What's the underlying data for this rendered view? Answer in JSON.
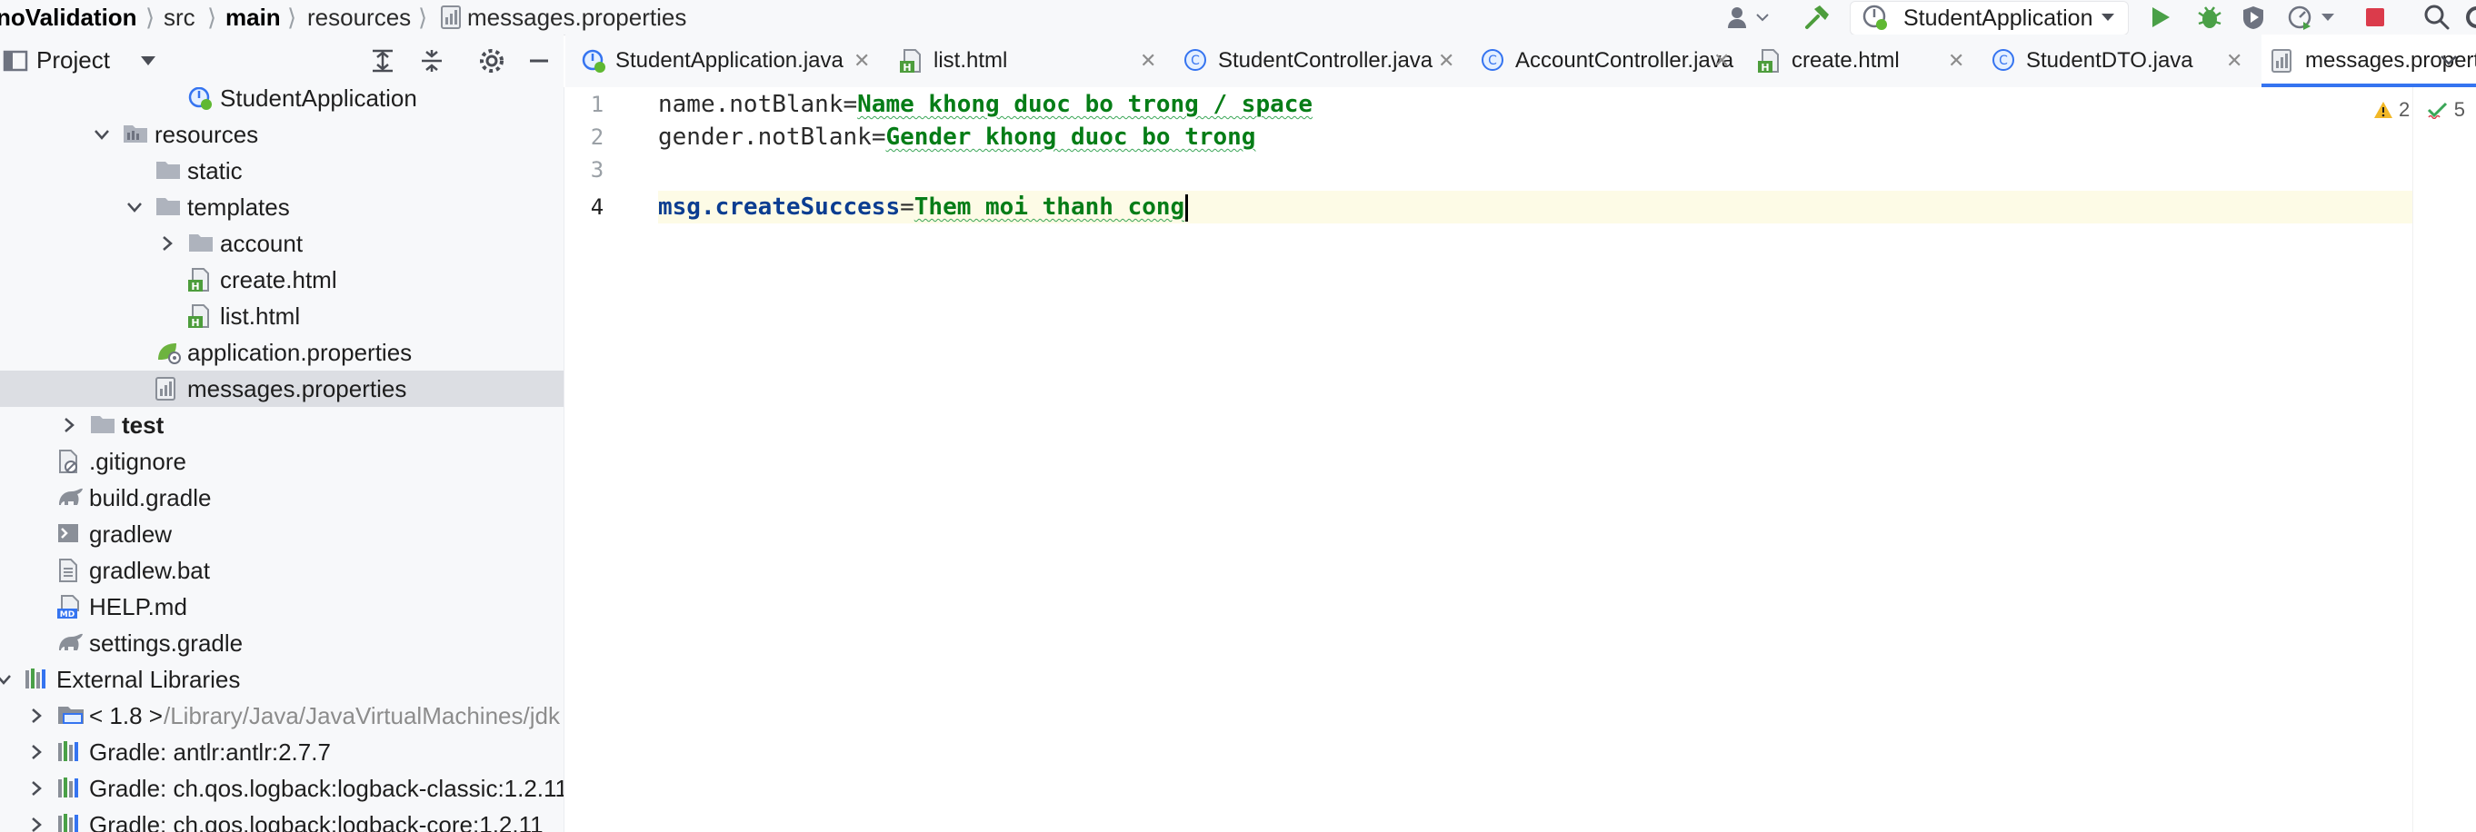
{
  "breadcrumb": {
    "items": [
      "noValidation",
      "src",
      "main",
      "resources",
      "messages.properties"
    ],
    "separator": "⟩"
  },
  "toolbar": {
    "run_config": "StudentApplication"
  },
  "project_panel": {
    "title": "Project",
    "tree": [
      {
        "label": "StudentApplication",
        "icon": "spring-boot-run-icon",
        "depth": 5,
        "chevron": "none"
      },
      {
        "label": "resources",
        "icon": "resources-folder-icon",
        "depth": 3,
        "chevron": "down"
      },
      {
        "label": "static",
        "icon": "folder-icon",
        "depth": 4,
        "chevron": "none"
      },
      {
        "label": "templates",
        "icon": "folder-icon",
        "depth": 4,
        "chevron": "down"
      },
      {
        "label": "account",
        "icon": "folder-icon",
        "depth": 5,
        "chevron": "right"
      },
      {
        "label": "create.html",
        "icon": "html-file-icon",
        "depth": 5,
        "chevron": "none"
      },
      {
        "label": "list.html",
        "icon": "html-file-icon",
        "depth": 5,
        "chevron": "none"
      },
      {
        "label": "application.properties",
        "icon": "spring-properties-icon",
        "depth": 4,
        "chevron": "none"
      },
      {
        "label": "messages.properties",
        "icon": "properties-file-icon",
        "depth": 4,
        "chevron": "none",
        "selected": true
      },
      {
        "label": "test",
        "icon": "folder-icon",
        "depth": 2,
        "chevron": "right",
        "bold": true
      },
      {
        "label": ".gitignore",
        "icon": "gitignore-file-icon",
        "depth": 1,
        "chevron": "none"
      },
      {
        "label": "build.gradle",
        "icon": "gradle-elephant-icon",
        "depth": 1,
        "chevron": "none"
      },
      {
        "label": "gradlew",
        "icon": "shell-script-icon",
        "depth": 1,
        "chevron": "none"
      },
      {
        "label": "gradlew.bat",
        "icon": "text-file-icon",
        "depth": 1,
        "chevron": "none"
      },
      {
        "label": "HELP.md",
        "icon": "markdown-file-icon",
        "depth": 1,
        "chevron": "none"
      },
      {
        "label": "settings.gradle",
        "icon": "gradle-elephant-icon",
        "depth": 1,
        "chevron": "none"
      },
      {
        "label": "External Libraries",
        "icon": "library-icon",
        "depth": 0,
        "chevron": "down"
      },
      {
        "label": "< 1.8 >",
        "suffix": " /Library/Java/JavaVirtualMachines/jdk",
        "icon": "jdk-icon",
        "depth": 1,
        "chevron": "right"
      },
      {
        "label": "Gradle: antlr:antlr:2.7.7",
        "icon": "library-icon",
        "depth": 1,
        "chevron": "right"
      },
      {
        "label": "Gradle: ch.qos.logback:logback-classic:1.2.11",
        "icon": "library-icon",
        "depth": 1,
        "chevron": "right"
      },
      {
        "label": "Gradle: ch.qos.logback:logback-core:1.2.11",
        "icon": "library-icon",
        "depth": 1,
        "chevron": "right"
      }
    ]
  },
  "tabs": [
    {
      "label": "StudentApplication.java",
      "icon": "spring-boot-run-icon"
    },
    {
      "label": "list.html",
      "icon": "html-file-icon"
    },
    {
      "label": "StudentController.java",
      "icon": "class-icon"
    },
    {
      "label": "AccountController.java",
      "icon": "class-icon"
    },
    {
      "label": "create.html",
      "icon": "html-file-icon"
    },
    {
      "label": "StudentDTO.java",
      "icon": "class-icon"
    },
    {
      "label": "messages.properties",
      "icon": "properties-file-icon",
      "active": true
    }
  ],
  "editor": {
    "inspections": {
      "warnings": "2",
      "typos": "5"
    },
    "lines": [
      {
        "number": "1",
        "key": "name.notBlank",
        "value": "Name khong duoc bo trong / space"
      },
      {
        "number": "2",
        "key": "gender.notBlank",
        "value": "Gender khong duoc bo trong"
      },
      {
        "number": "3",
        "key": "",
        "value": ""
      },
      {
        "number": "4",
        "key": "msg.createSuccess",
        "value": "Them moi thanh cong",
        "current": true
      }
    ]
  },
  "colors": {
    "accent": "#3574f0",
    "value_green": "#067d17",
    "key_blue": "#0b3d91",
    "selection": "#dcdee3",
    "current_line": "#fdfbe6"
  }
}
